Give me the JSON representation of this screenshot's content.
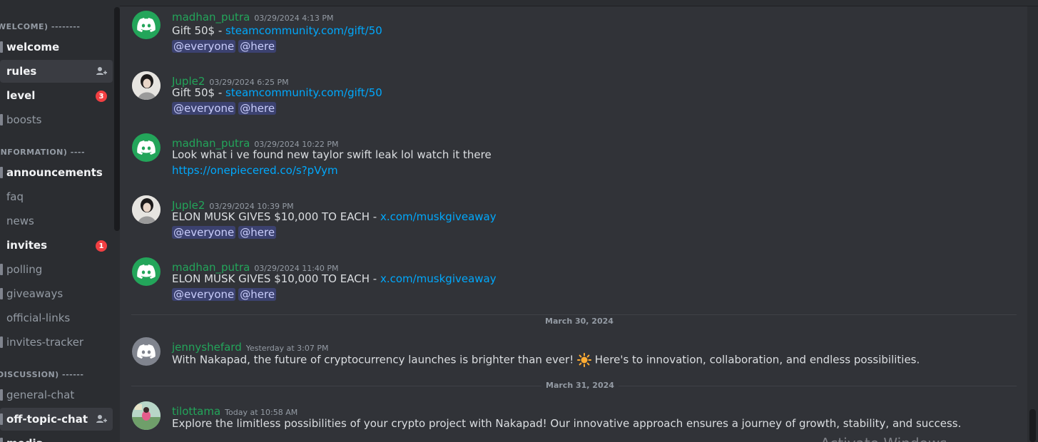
{
  "sidebar": {
    "categories": [
      {
        "label": "WELCOME) --------"
      },
      {
        "label": "INFORMATION) ----"
      },
      {
        "label": "DISCUSSION) ------"
      }
    ],
    "channels": [
      {
        "label": "welcome"
      },
      {
        "label": "rules"
      },
      {
        "label": "level",
        "badge": "3"
      },
      {
        "label": "boosts"
      },
      {
        "label": "announcements"
      },
      {
        "label": "faq"
      },
      {
        "label": "news"
      },
      {
        "label": "invites",
        "badge": "1"
      },
      {
        "label": "polling"
      },
      {
        "label": "giveaways"
      },
      {
        "label": "official-links"
      },
      {
        "label": "invites-tracker"
      },
      {
        "label": "general-chat"
      },
      {
        "label": "off-topic-chat"
      },
      {
        "label": "media"
      }
    ]
  },
  "messages": [
    {
      "username": "madhan_putra",
      "timestamp": "03/29/2024 4:13 PM",
      "text": "Gift 50$ - ",
      "link": "steamcommunity.com/gift/50",
      "mentions": [
        "@everyone",
        "@here"
      ]
    },
    {
      "username": "Juple2",
      "timestamp": "03/29/2024 6:25 PM",
      "text": "Gift 50$ - ",
      "link": "steamcommunity.com/gift/50",
      "mentions": [
        "@everyone",
        "@here"
      ]
    },
    {
      "username": "madhan_putra",
      "timestamp": "03/29/2024 10:22 PM",
      "text": "Look what i ve found new taylor swift leak lol watch it there",
      "link": "https://onepiecered.co/s?pVym"
    },
    {
      "username": "Juple2",
      "timestamp": "03/29/2024 10:39 PM",
      "text": "ELON MUSK GIVES $10,000 TO EACH - ",
      "link": "x.com/muskgiveaway",
      "mentions": [
        "@everyone",
        "@here"
      ]
    },
    {
      "username": "madhan_putra",
      "timestamp": "03/29/2024 11:40 PM",
      "text": "ELON MUSK GIVES $10,000 TO EACH - ",
      "link": "x.com/muskgiveaway",
      "mentions": [
        "@everyone",
        "@here"
      ]
    },
    {
      "username": "jennyshefard",
      "timestamp": "Yesterday at 3:07 PM",
      "text": "With Nakapad, the future of cryptocurrency launches is brighter than ever! ",
      "text2": " Here's to innovation, collaboration, and endless possibilities."
    },
    {
      "username": "tilottama",
      "timestamp": "Today at 10:58 AM",
      "text": "Explore the limitless possibilities of your crypto project with Nakapad! Our innovative approach ensures a journey of growth, stability, and success."
    }
  ],
  "dividers": [
    "March 30, 2024",
    "March 31, 2024"
  ],
  "watermark": "Activate Windows",
  "colors": {
    "username": "#23a55a",
    "link": "#00a8fc",
    "badge": "#f23f42",
    "mention_bg": "#3c4270"
  }
}
